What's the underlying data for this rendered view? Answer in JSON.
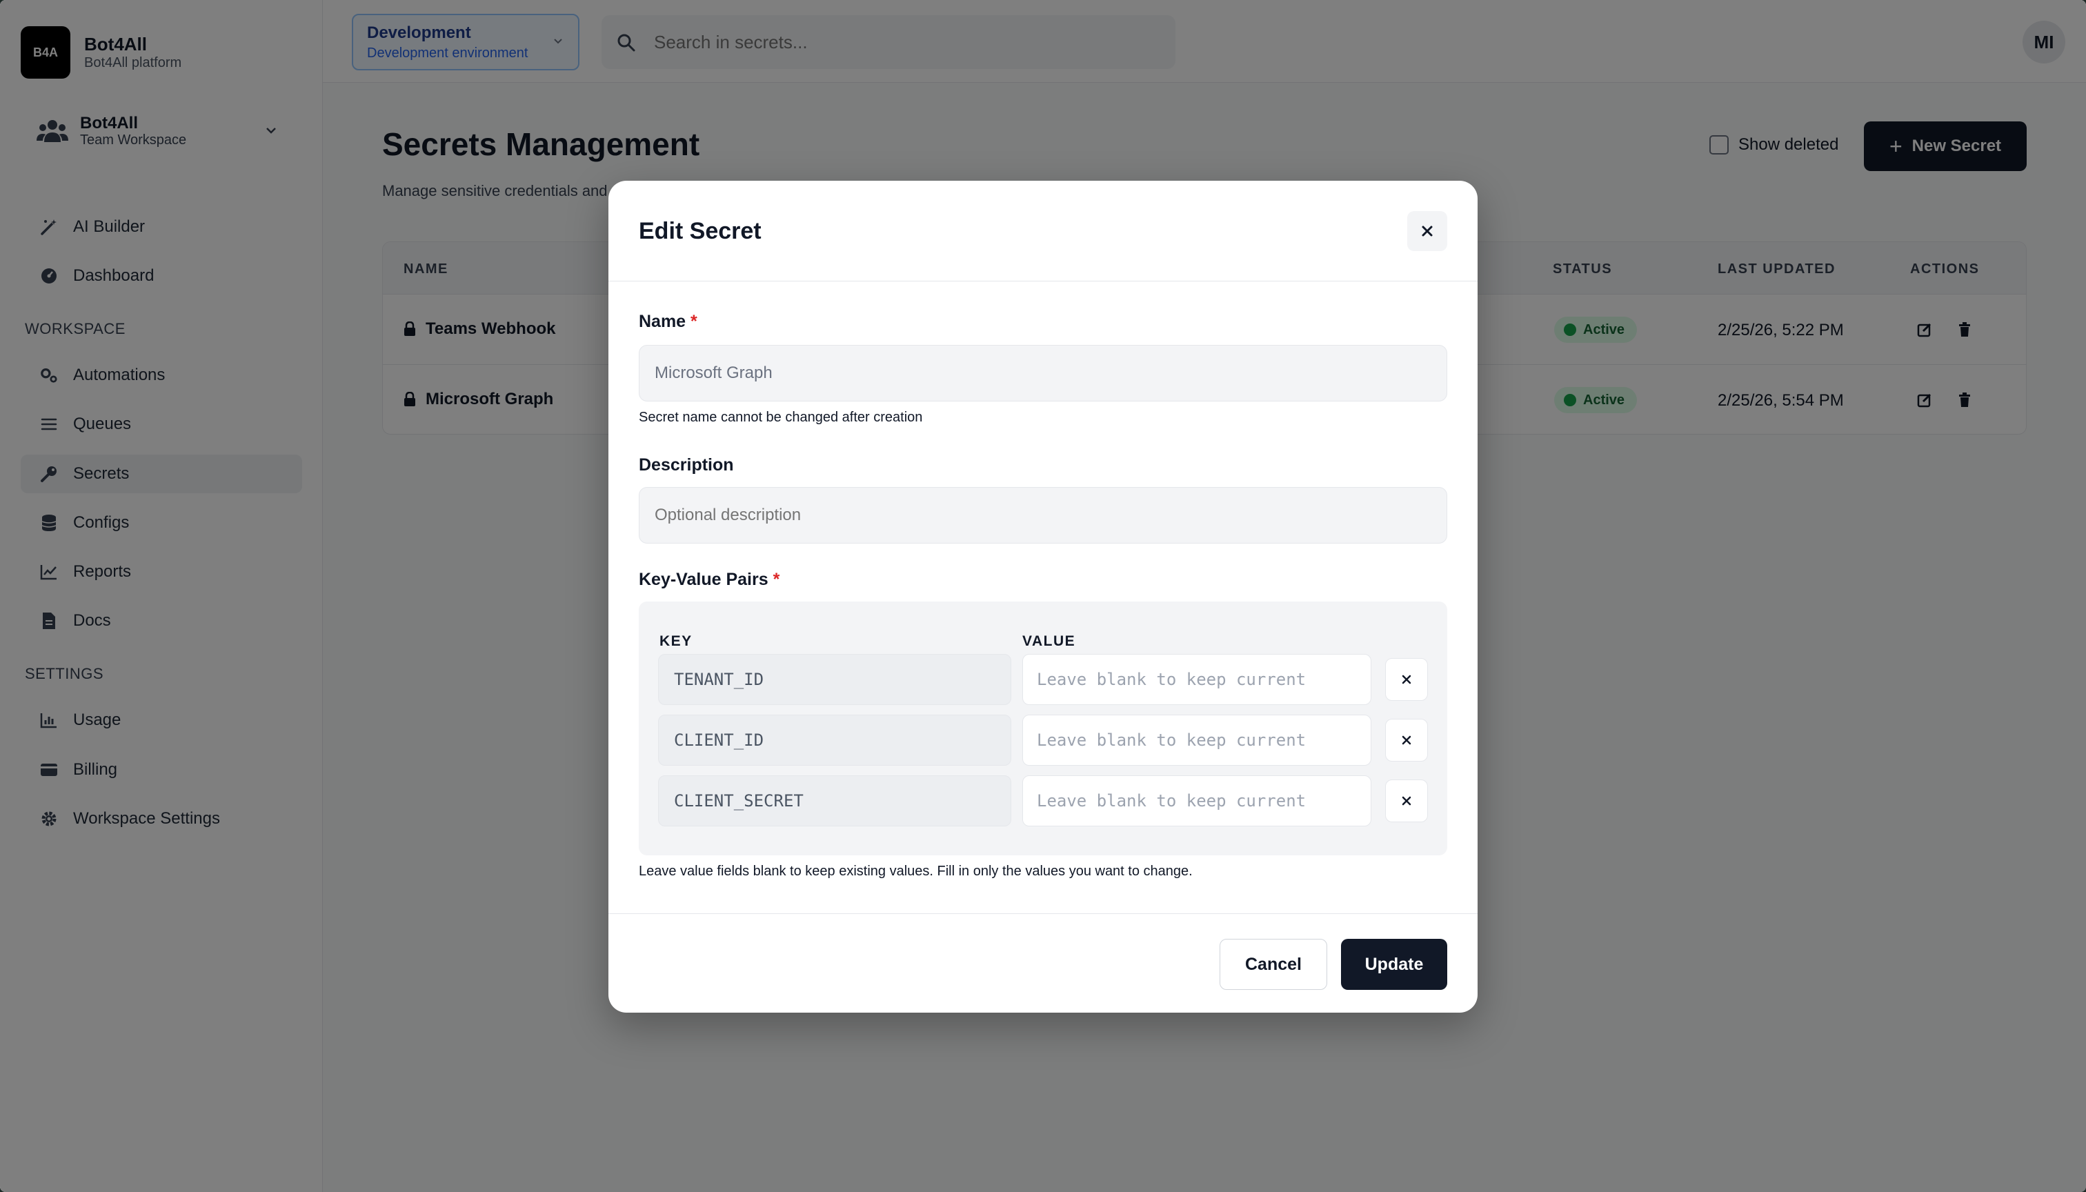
{
  "brand": {
    "logo": "B4A",
    "title": "Bot4All",
    "subtitle": "Bot4All platform"
  },
  "team": {
    "title": "Bot4All",
    "subtitle": "Team Workspace"
  },
  "nav": {
    "main": [
      {
        "label": "AI Builder",
        "icon": "magic-wand-icon"
      },
      {
        "label": "Dashboard",
        "icon": "gauge-icon"
      }
    ],
    "workspace_label": "WORKSPACE",
    "workspace": [
      {
        "label": "Automations",
        "icon": "cogs-icon"
      },
      {
        "label": "Queues",
        "icon": "list-icon"
      },
      {
        "label": "Secrets",
        "icon": "key-icon",
        "active": true
      },
      {
        "label": "Configs",
        "icon": "database-icon"
      },
      {
        "label": "Reports",
        "icon": "chart-line-icon"
      },
      {
        "label": "Docs",
        "icon": "document-icon"
      }
    ],
    "settings_label": "SETTINGS",
    "settings": [
      {
        "label": "Usage",
        "icon": "chart-bar-icon"
      },
      {
        "label": "Billing",
        "icon": "credit-card-icon"
      },
      {
        "label": "Workspace Settings",
        "icon": "gear-icon"
      }
    ]
  },
  "env": {
    "title": "Development",
    "subtitle": "Development environment"
  },
  "search": {
    "placeholder": "Search in secrets..."
  },
  "user": {
    "initials": "MI"
  },
  "page": {
    "title": "Secrets Management",
    "description": "Manage sensitive credentials and",
    "show_deleted": "Show deleted",
    "new_button": "New Secret"
  },
  "table": {
    "columns": {
      "name": "NAME",
      "status": "STATUS",
      "updated": "LAST UPDATED",
      "actions": "ACTIONS"
    },
    "rows": [
      {
        "name": "Teams Webhook",
        "status": "Active",
        "updated": "2/25/26, 5:22 PM"
      },
      {
        "name": "Microsoft Graph",
        "status": "Active",
        "updated": "2/25/26, 5:54 PM"
      }
    ]
  },
  "modal": {
    "title": "Edit Secret",
    "name_label": "Name",
    "required_mark": "*",
    "name_value": "Microsoft Graph",
    "name_help": "Secret name cannot be changed after creation",
    "description_label": "Description",
    "description_placeholder": "Optional description",
    "kv_label": "Key-Value Pairs",
    "kv_key_header": "KEY",
    "kv_value_header": "VALUE",
    "pairs": [
      {
        "key": "TENANT_ID",
        "value_placeholder": "Leave blank to keep current"
      },
      {
        "key": "CLIENT_ID",
        "value_placeholder": "Leave blank to keep current"
      },
      {
        "key": "CLIENT_SECRET",
        "value_placeholder": "Leave blank to keep current"
      }
    ],
    "kv_help": "Leave value fields blank to keep existing values. Fill in only the values you want to change.",
    "cancel": "Cancel",
    "update": "Update"
  },
  "colors": {
    "primary": "#111827",
    "env_accent": "#2563eb",
    "active_badge": "#dcfce7",
    "required": "#dc2626"
  }
}
